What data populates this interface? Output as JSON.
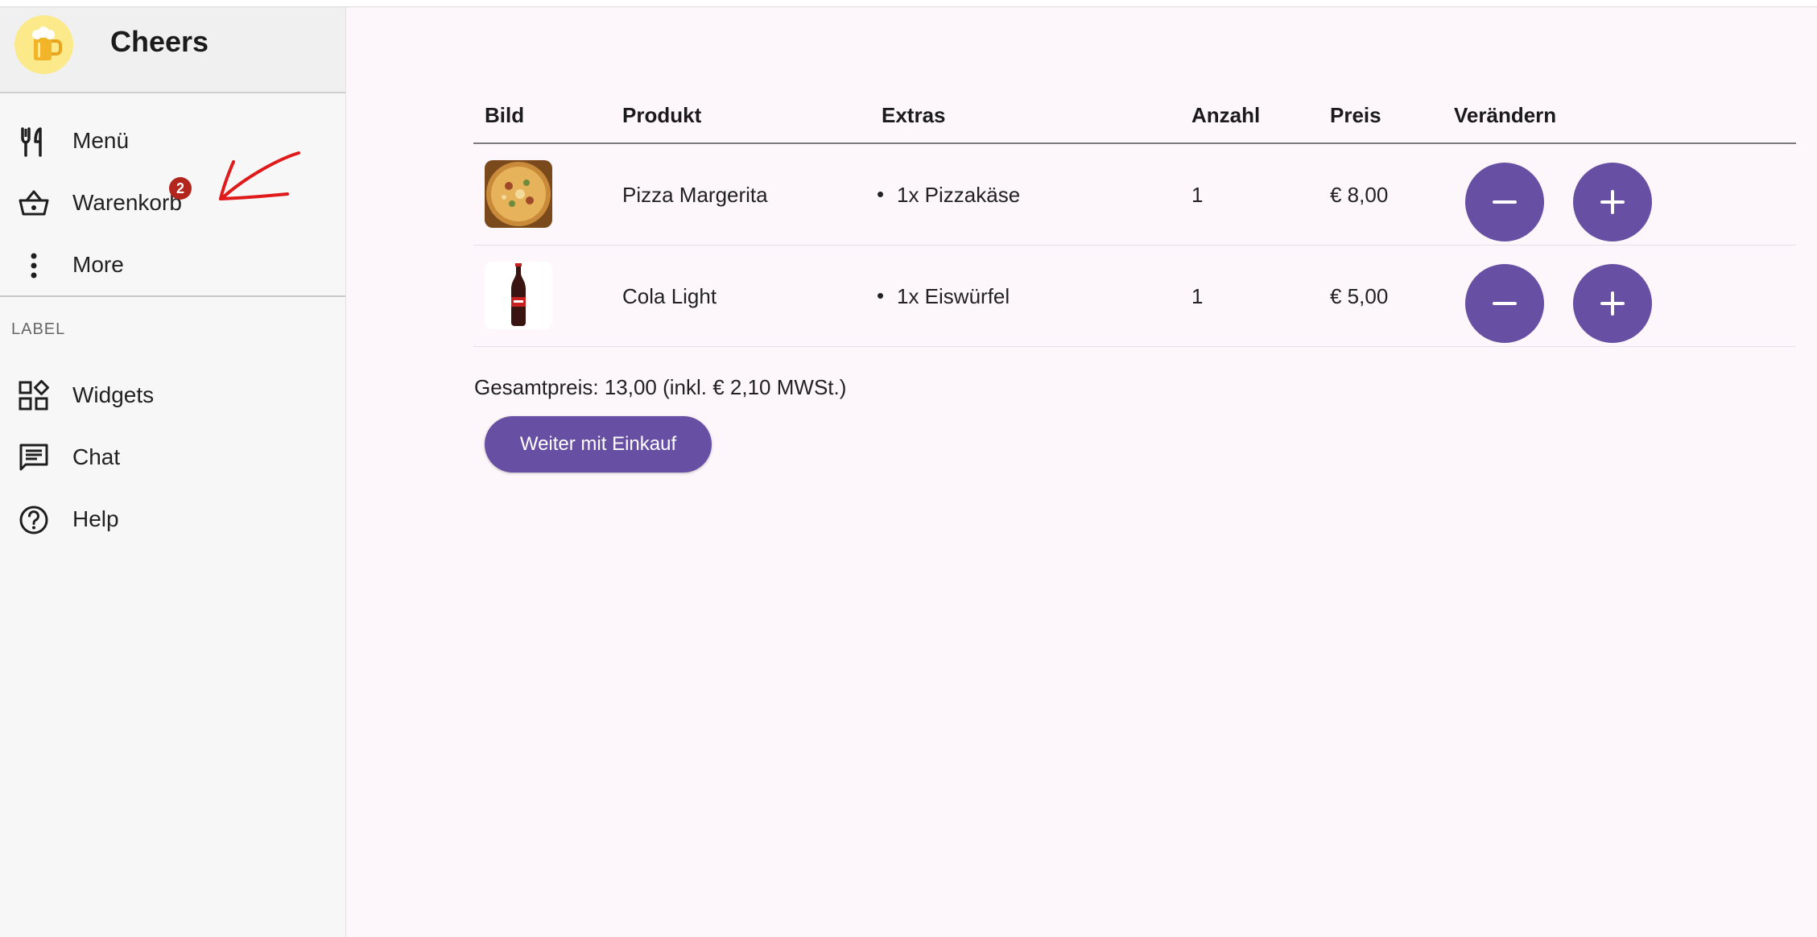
{
  "app": {
    "title": "Cheers",
    "accent_color": "#6750a4",
    "badge_color": "#b3261e",
    "logo_icon": "beer-mug-icon"
  },
  "sidebar": {
    "items": [
      {
        "label": "Menü",
        "icon": "utensils-icon"
      },
      {
        "label": "Warenkorb",
        "icon": "basket-icon",
        "badge": "2"
      },
      {
        "label": "More",
        "icon": "more-vertical-icon"
      }
    ],
    "section_label": "LABEL",
    "section_items": [
      {
        "label": "Widgets",
        "icon": "widgets-icon"
      },
      {
        "label": "Chat",
        "icon": "chat-icon"
      },
      {
        "label": "Help",
        "icon": "help-circle-icon"
      }
    ]
  },
  "cart": {
    "columns": [
      "Bild",
      "Produkt",
      "Extras",
      "Anzahl",
      "Preis",
      "Verändern"
    ],
    "rows": [
      {
        "image": "pizza-image",
        "product": "Pizza Margerita",
        "extras": [
          "1x Pizzakäse"
        ],
        "quantity": "1",
        "price": "€ 8,00"
      },
      {
        "image": "cola-bottle-image",
        "product": "Cola Light",
        "extras": [
          "1x Eiswürfel"
        ],
        "quantity": "1",
        "price": "€ 5,00"
      }
    ],
    "total_text": "Gesamtpreis: 13,00 (inkl. € 2,10 MWSt.)",
    "checkout_label": "Weiter mit Einkauf",
    "decrement_icon": "minus-icon",
    "increment_icon": "plus-icon"
  }
}
